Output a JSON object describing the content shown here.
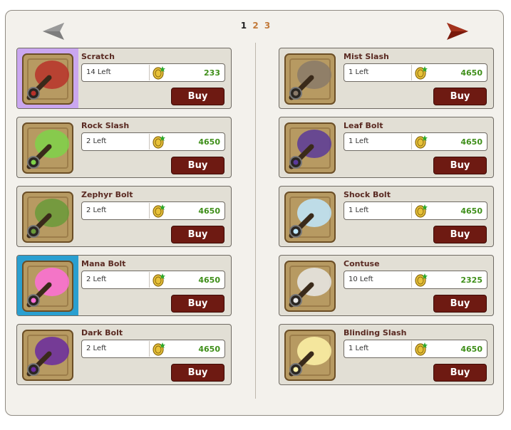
{
  "pagination": {
    "current": "1",
    "others": [
      "2",
      "3"
    ]
  },
  "icons": {
    "prev": "arrow-left-icon",
    "next": "arrow-right-icon",
    "currency": "coin-icon"
  },
  "button_label": "Buy",
  "items": [
    {
      "name": "Scratch",
      "stock": "14 Left",
      "price": "233",
      "highlight": "purple",
      "image": "scratch-staff-icon"
    },
    {
      "name": "Mist Slash",
      "stock": "1 Left",
      "price": "4650",
      "highlight": "",
      "image": "mist-slash-staff-icon"
    },
    {
      "name": "Rock Slash",
      "stock": "2 Left",
      "price": "4650",
      "highlight": "",
      "image": "rock-slash-staff-icon"
    },
    {
      "name": "Leaf Bolt",
      "stock": "1 Left",
      "price": "4650",
      "highlight": "",
      "image": "leaf-bolt-staff-icon"
    },
    {
      "name": "Zephyr Bolt",
      "stock": "2 Left",
      "price": "4650",
      "highlight": "",
      "image": "zephyr-bolt-staff-icon"
    },
    {
      "name": "Shock Bolt",
      "stock": "1 Left",
      "price": "4650",
      "highlight": "",
      "image": "shock-bolt-staff-icon"
    },
    {
      "name": "Mana Bolt",
      "stock": "2 Left",
      "price": "4650",
      "highlight": "blue",
      "image": "mana-bolt-staff-icon"
    },
    {
      "name": "Contuse",
      "stock": "10 Left",
      "price": "2325",
      "highlight": "",
      "image": "contuse-staff-icon"
    },
    {
      "name": "Dark Bolt",
      "stock": "2 Left",
      "price": "4650",
      "highlight": "",
      "image": "dark-bolt-staff-icon"
    },
    {
      "name": "Blinding Slash",
      "stock": "1 Left",
      "price": "4650",
      "highlight": "",
      "image": "blinding-slash-staff-icon"
    }
  ],
  "colors": {
    "panel_bg": "#f3f1ec",
    "card_bg": "#e2dfd5",
    "name_text": "#5a2a22",
    "price_text": "#3f8f1a",
    "buy_button": "#6e1a12",
    "highlight_purple": "#caa7f0",
    "highlight_blue": "#2a9fd0"
  }
}
